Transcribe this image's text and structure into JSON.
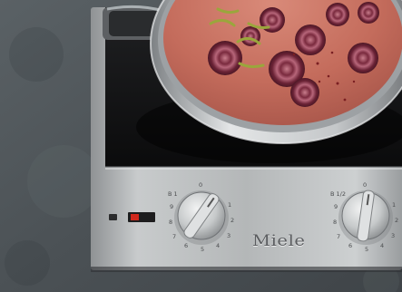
{
  "image": {
    "description_visible_text": "",
    "brand": "Miele"
  },
  "knobs": [
    {
      "name": "left-burner-knob",
      "labels": [
        "0",
        "1",
        "2",
        "3",
        "4",
        "5",
        "6",
        "7",
        "8",
        "9",
        "B 1"
      ],
      "top_label": "0"
    },
    {
      "name": "right-burner-knob",
      "labels": [
        "0",
        "1",
        "2",
        "3",
        "4",
        "5",
        "6",
        "7",
        "8",
        "9",
        "B 1/2"
      ],
      "top_label": "0"
    }
  ],
  "colors": {
    "countertop": "#4e5458",
    "steel": "#b9bcbd",
    "glass": "#121212",
    "soup": "#c97060",
    "pot_steel": "#cfd2d4",
    "indicator_red": "#c0261c"
  }
}
